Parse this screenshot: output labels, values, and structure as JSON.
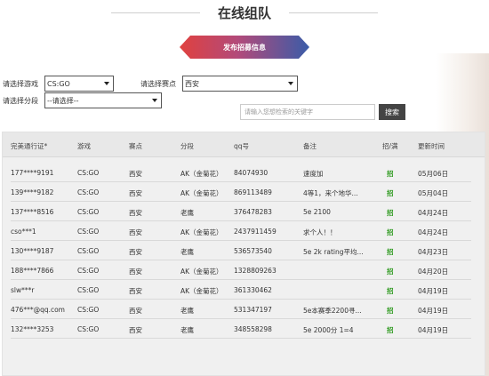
{
  "header": {
    "title": "在线组队"
  },
  "publish_button": {
    "label": "发布招募信息"
  },
  "filters": {
    "game_label": "请选择游戏",
    "game_value": "CS:GO",
    "venue_label": "请选择赛点",
    "venue_value": "西安",
    "rank_label": "请选择分段",
    "rank_value": "--请选择--"
  },
  "search": {
    "placeholder": "请输入您想检索的关键字",
    "button_label": "搜索"
  },
  "table": {
    "columns": [
      "完美通行证*",
      "游戏",
      "赛点",
      "分段",
      "qq号",
      "备注",
      "招/满",
      "更新时间"
    ],
    "rows": [
      {
        "pass": "177****9191",
        "game": "CS:GO",
        "venue": "西安",
        "rank": "AK（金菊花）",
        "qq": "84074930",
        "note": "速度加",
        "status": "招",
        "time": "05月06日"
      },
      {
        "pass": "139****9182",
        "game": "CS:GO",
        "venue": "西安",
        "rank": "AK（金菊花）",
        "qq": "869113489",
        "note": "4等1，来个地华...",
        "status": "招",
        "time": "05月04日"
      },
      {
        "pass": "137****8516",
        "game": "CS:GO",
        "venue": "西安",
        "rank": "老鹰",
        "qq": "376478283",
        "note": "5e 2100",
        "status": "招",
        "time": "04月24日"
      },
      {
        "pass": "cso***1",
        "game": "CS:GO",
        "venue": "西安",
        "rank": "AK（金菊花）",
        "qq": "2437911459",
        "note": "求个人！！",
        "status": "招",
        "time": "04月24日"
      },
      {
        "pass": "130****9187",
        "game": "CS:GO",
        "venue": "西安",
        "rank": "老鹰",
        "qq": "536573540",
        "note": "5e 2k rating平均...",
        "status": "招",
        "time": "04月23日"
      },
      {
        "pass": "188****7866",
        "game": "CS:GO",
        "venue": "西安",
        "rank": "AK（金菊花）",
        "qq": "1328809263",
        "note": "",
        "status": "招",
        "time": "04月20日"
      },
      {
        "pass": "slw***r",
        "game": "CS:GO",
        "venue": "西安",
        "rank": "AK（金菊花）",
        "qq": "361330462",
        "note": "",
        "status": "招",
        "time": "04月19日"
      },
      {
        "pass": "476***@qq.com",
        "game": "CS:GO",
        "venue": "西安",
        "rank": "老鹰",
        "qq": "531347197",
        "note": "5e本赛季2200寻...",
        "status": "招",
        "time": "04月19日"
      },
      {
        "pass": "132****3253",
        "game": "CS:GO",
        "venue": "西安",
        "rank": "老鹰",
        "qq": "348558298",
        "note": "5e 2000分 1=4",
        "status": "招",
        "time": "04月19日"
      }
    ]
  },
  "colors": {
    "accent_red": "#e0413f",
    "accent_blue": "#3a5ca8",
    "recruit_green": "#2e9a1f"
  }
}
